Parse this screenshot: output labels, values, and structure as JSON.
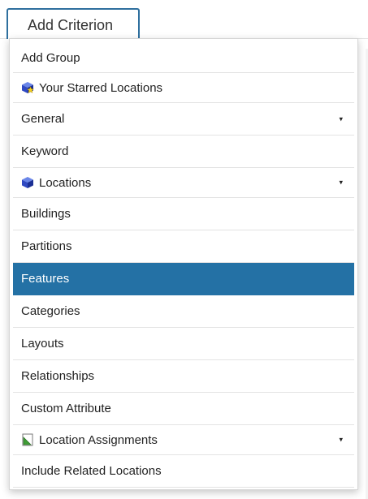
{
  "header": {
    "add_button_label": "Add Criterion"
  },
  "menu": {
    "items": [
      {
        "label": "Add Group"
      },
      {
        "label": "Your Starred Locations",
        "icon": "starred-cube-icon"
      },
      {
        "label": "General",
        "submenu_caret": "▾"
      },
      {
        "label": "Keyword"
      },
      {
        "label": "Locations",
        "icon": "cube-icon",
        "submenu_caret": "▾"
      },
      {
        "label": "Buildings"
      },
      {
        "label": "Partitions"
      },
      {
        "label": "Features",
        "selected": true
      },
      {
        "label": "Categories"
      },
      {
        "label": "Layouts"
      },
      {
        "label": "Relationships"
      },
      {
        "label": "Custom Attribute"
      },
      {
        "label": "Location Assignments",
        "icon": "assignment-icon",
        "submenu_caret": "▾"
      },
      {
        "label": "Include Related Locations"
      }
    ]
  },
  "colors": {
    "accent": "#2471a5",
    "button_border": "#2e6f9e",
    "selected_text": "#ffffff"
  }
}
